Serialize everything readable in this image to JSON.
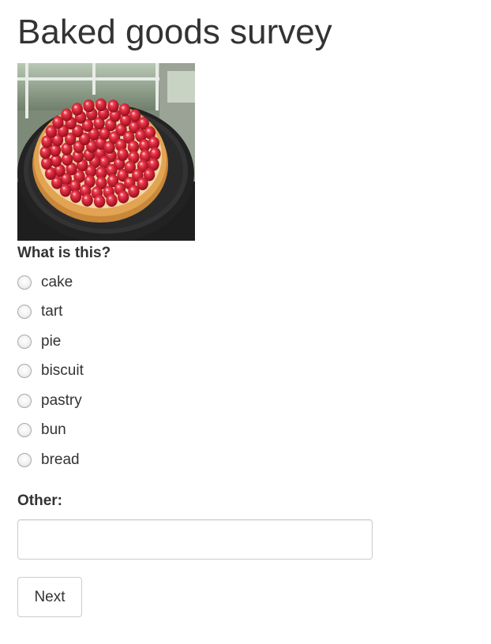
{
  "survey": {
    "title": "Baked goods survey",
    "image_subject": "raspberry tart on dark plate",
    "question": "What is this?",
    "options": [
      {
        "label": "cake",
        "selected": false
      },
      {
        "label": "tart",
        "selected": false
      },
      {
        "label": "pie",
        "selected": false
      },
      {
        "label": "biscuit",
        "selected": false
      },
      {
        "label": "pastry",
        "selected": false
      },
      {
        "label": "bun",
        "selected": false
      },
      {
        "label": "bread",
        "selected": false
      }
    ],
    "other_label": "Other:",
    "other_value": "",
    "other_placeholder": "",
    "next_label": "Next"
  },
  "colors": {
    "text": "#333333",
    "border": "#cccccc",
    "raspberry": "#d0263a",
    "crust": "#e2a453",
    "plate": "#262626"
  }
}
